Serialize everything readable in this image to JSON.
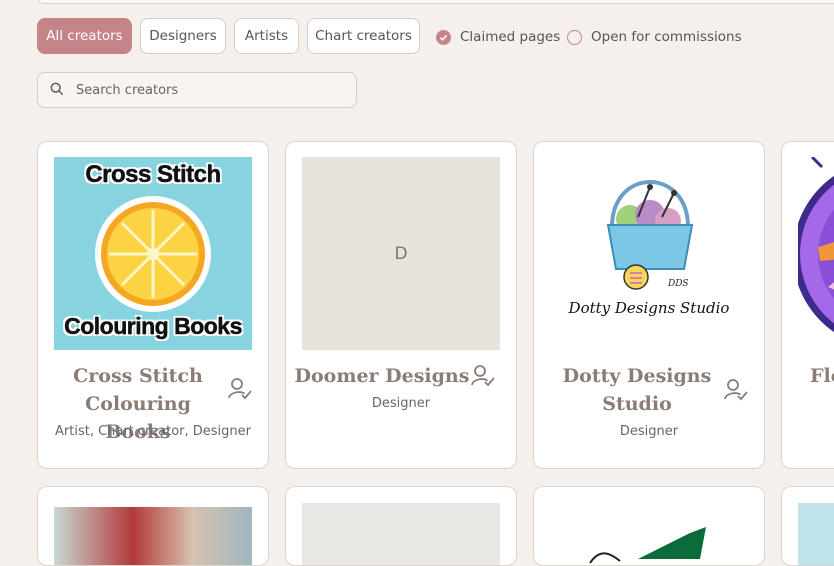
{
  "filters": {
    "tabs": [
      {
        "label": "All creators",
        "active": true
      },
      {
        "label": "Designers",
        "active": false
      },
      {
        "label": "Artists",
        "active": false
      },
      {
        "label": "Chart creators",
        "active": false
      }
    ],
    "checkboxes": [
      {
        "label": "Claimed pages",
        "checked": true
      },
      {
        "label": "Open for commissions",
        "checked": false
      }
    ]
  },
  "search": {
    "placeholder": "Search creators"
  },
  "colors": {
    "accent": "#c48488",
    "background": "#f5f0ec",
    "name": "#8a7c76"
  },
  "creators": [
    {
      "name": "Cross Stitch Colouring Books",
      "roles": "Artist, Chart creator, Designer",
      "image_text_top": "Cross Stitch",
      "image_text_bottom": "Colouring Books",
      "claimed": true
    },
    {
      "name": "Doomer Designs",
      "roles": "Designer",
      "initial": "D",
      "claimed": true
    },
    {
      "name": "Dotty Designs Studio",
      "roles": "Designer",
      "logo_text": "Dotty Designs Studio",
      "logo_initials": "DDS",
      "claimed": true
    },
    {
      "name": "Flo"
    }
  ]
}
